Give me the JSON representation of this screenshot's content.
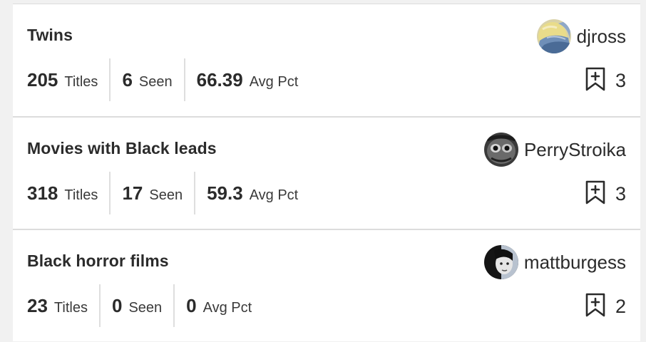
{
  "lists": [
    {
      "title": "Twins",
      "owner": "djross",
      "avatar_icon": "painting-avatar",
      "stats": [
        {
          "value": "205",
          "label": "Titles"
        },
        {
          "value": "6",
          "label": "Seen"
        },
        {
          "value": "66.39",
          "label": "Avg Pct"
        }
      ],
      "save_count": "3"
    },
    {
      "title": "Movies with Black leads",
      "owner": "PerryStroika",
      "avatar_icon": "face-avatar",
      "stats": [
        {
          "value": "318",
          "label": "Titles"
        },
        {
          "value": "17",
          "label": "Seen"
        },
        {
          "value": "59.3",
          "label": "Avg Pct"
        }
      ],
      "save_count": "3"
    },
    {
      "title": "Black horror films",
      "owner": "mattburgess",
      "avatar_icon": "portrait-avatar",
      "stats": [
        {
          "value": "23",
          "label": "Titles"
        },
        {
          "value": "0",
          "label": "Seen"
        },
        {
          "value": "0",
          "label": "Avg Pct"
        }
      ],
      "save_count": "2"
    }
  ]
}
